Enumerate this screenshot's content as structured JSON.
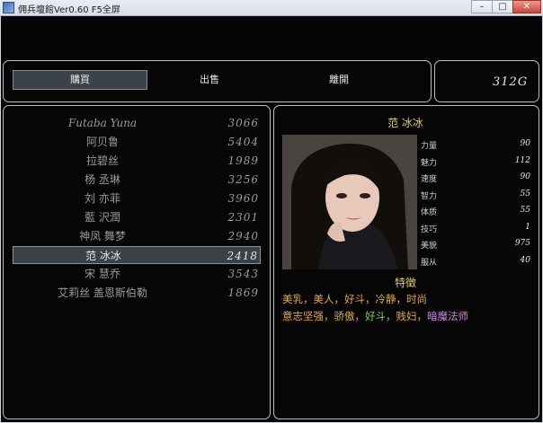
{
  "window": {
    "title": "佣兵壇館Ver0.60 F5全屏",
    "min_glyph": "–",
    "max_glyph": "□",
    "close_glyph": "✕"
  },
  "menu": {
    "buy": "購買",
    "sell": "出售",
    "leave": "離開"
  },
  "gold": "312G",
  "roster": [
    {
      "name": "Futaba Yuna",
      "price": "3066"
    },
    {
      "name": "阿贝鲁",
      "price": "5404"
    },
    {
      "name": "拉碧丝",
      "price": "1989"
    },
    {
      "name": "杨 丞琳",
      "price": "3256"
    },
    {
      "name": "刘 亦菲",
      "price": "3960"
    },
    {
      "name": "藍 沢潤",
      "price": "2301"
    },
    {
      "name": "神凤 舞梦",
      "price": "2940"
    },
    {
      "name": "范 冰冰",
      "price": "2418",
      "selected": true
    },
    {
      "name": "宋 慧乔",
      "price": "3543"
    },
    {
      "name": "艾莉丝 盖恩斯伯勒",
      "price": "1869"
    }
  ],
  "character": {
    "name": "范 冰冰",
    "stats": [
      {
        "label": "力量",
        "value": "90"
      },
      {
        "label": "魅力",
        "value": "112"
      },
      {
        "label": "速度",
        "value": "90"
      },
      {
        "label": "智力",
        "value": "55"
      },
      {
        "label": "体质",
        "value": "55"
      },
      {
        "label": "技巧",
        "value": "1"
      },
      {
        "label": "美貌",
        "value": "975"
      },
      {
        "label": "服从",
        "value": "40"
      }
    ],
    "traits_title": "特徵",
    "traits_line1": [
      {
        "text": "美乳，",
        "color": "#e0a84a"
      },
      {
        "text": "美人，",
        "color": "#e0a84a"
      },
      {
        "text": "好斗，",
        "color": "#e0a84a"
      },
      {
        "text": "冷静，",
        "color": "#e0a84a"
      },
      {
        "text": "时尚",
        "color": "#e0a84a"
      }
    ],
    "traits_line2": [
      {
        "text": "意志坚强，",
        "color": "#e0a84a"
      },
      {
        "text": "骄傲，",
        "color": "#e0a84a"
      },
      {
        "text": "好斗",
        "color": "#7fd25c"
      },
      {
        "text": "，贱妇，",
        "color": "#e0a84a"
      },
      {
        "text": "暗魔法师",
        "color": "#c98ae0"
      }
    ]
  }
}
